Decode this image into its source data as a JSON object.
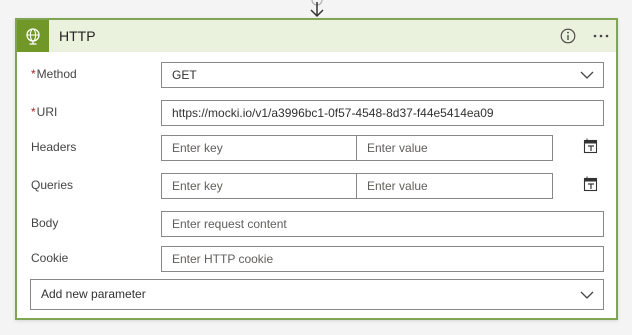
{
  "card": {
    "title": "HTTP",
    "icon": "globe-icon",
    "accent_color": "#709727",
    "header_bg": "#eaf1dd"
  },
  "fields": {
    "method": {
      "required_mark": "*",
      "label": "Method",
      "value": "GET"
    },
    "uri": {
      "required_mark": "*",
      "label": "URI",
      "value": "https://mocki.io/v1/a3996bc1-0f57-4548-8d37-f44e5414ea09"
    },
    "headers": {
      "label": "Headers",
      "key_placeholder": "Enter key",
      "value_placeholder": "Enter value"
    },
    "queries": {
      "label": "Queries",
      "key_placeholder": "Enter key",
      "value_placeholder": "Enter value"
    },
    "body": {
      "label": "Body",
      "placeholder": "Enter request content"
    },
    "cookie": {
      "label": "Cookie",
      "placeholder": "Enter HTTP cookie"
    }
  },
  "add_param": {
    "label": "Add new parameter"
  }
}
